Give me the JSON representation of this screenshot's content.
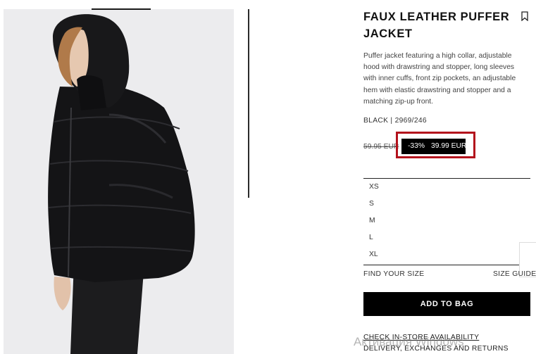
{
  "product": {
    "title": "FAUX LEATHER PUFFER JACKET",
    "description": "Puffer jacket featuring a high collar, adjustable hood with drawstring and stopper, long sleeves with inner cuffs, front zip pockets, an adjustable hem with elastic drawstring and stopper and a matching zip-up front.",
    "color_ref": "BLACK | 2969/246",
    "old_price": "59.95 EUR",
    "discount": "-33%",
    "price": "39.99 EUR"
  },
  "sizes": [
    "XS",
    "S",
    "M",
    "L",
    "XL"
  ],
  "links": {
    "find_size": "FIND YOUR SIZE",
    "size_guide": "SIZE GUIDE",
    "store_availability": "CHECK IN-STORE AVAILABILITY",
    "delivery": "DELIVERY, EXCHANGES AND RETURNS"
  },
  "actions": {
    "add_to_bag": "ADD TO BAG"
  },
  "icons": {
    "bookmark": "bookmark-icon"
  },
  "overlay": {
    "watermark": "Активация Windows"
  },
  "colors": {
    "highlight": "#b3121c",
    "button": "#000000",
    "background": "#ffffff"
  }
}
